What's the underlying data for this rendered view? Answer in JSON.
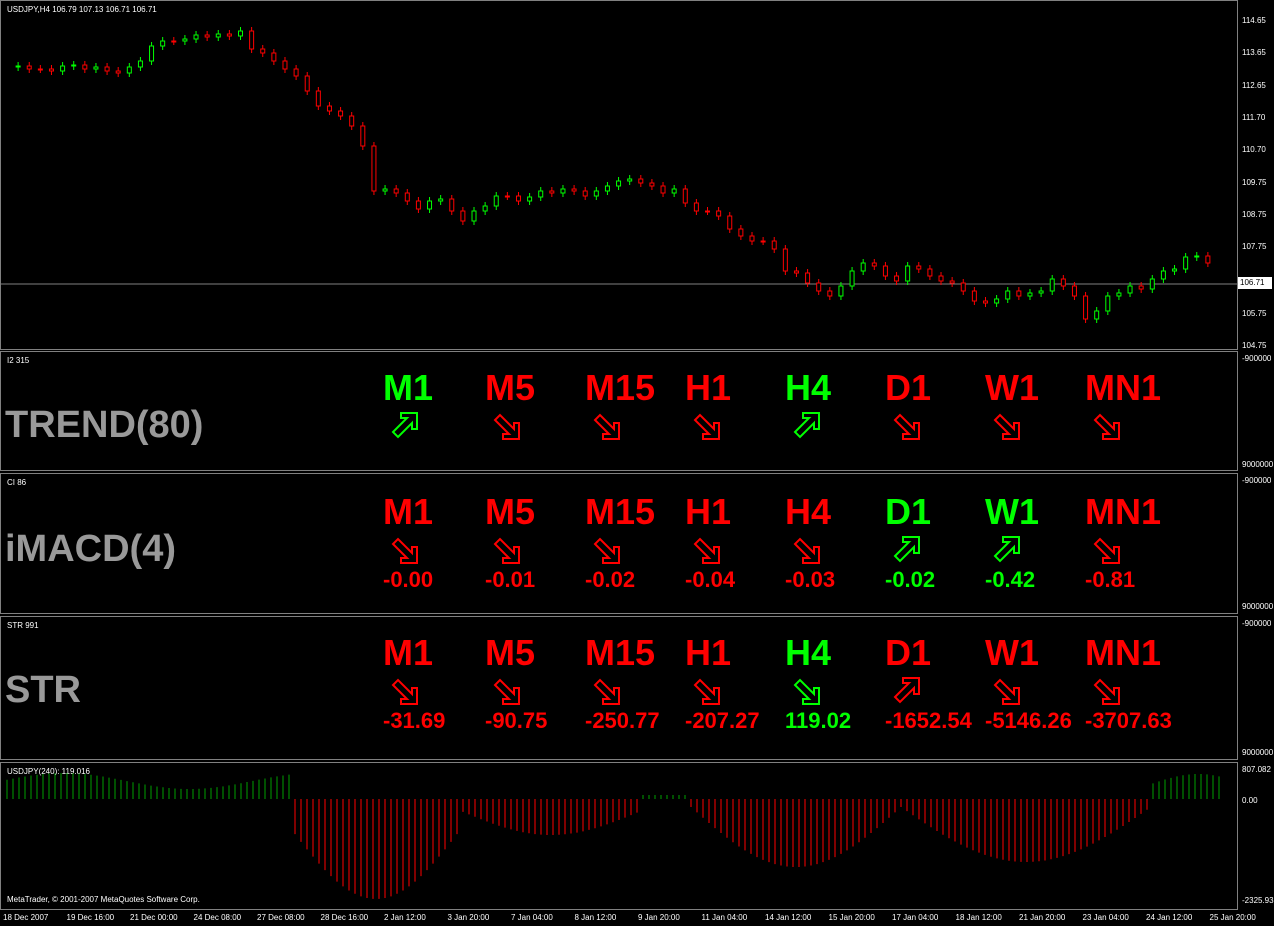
{
  "chart_title": "USDJPY,H4  106.79 107.13 106.71 106.71",
  "current_price": "106.71",
  "price_axis": [
    "114.65",
    "113.65",
    "112.65",
    "111.70",
    "110.70",
    "109.75",
    "108.75",
    "107.75",
    "105.75",
    "104.75"
  ],
  "date_axis": [
    "18 Dec 2007",
    "19 Dec 16:00",
    "21 Dec 00:00",
    "24 Dec 08:00",
    "27 Dec 08:00",
    "28 Dec 16:00",
    "2 Jan 12:00",
    "3 Jan 20:00",
    "7 Jan 04:00",
    "8 Jan 12:00",
    "9 Jan 20:00",
    "11 Jan 04:00",
    "14 Jan 12:00",
    "15 Jan 20:00",
    "17 Jan 04:00",
    "18 Jan 12:00",
    "21 Jan 20:00",
    "23 Jan 04:00",
    "24 Jan 12:00",
    "25 Jan 20:00"
  ],
  "colors": {
    "up": "#00ff00",
    "down": "#ff0000",
    "bg": "#000000"
  },
  "trend": {
    "pane_title": "I2 315",
    "name": "TREND(80)",
    "axis_top": "-900000",
    "axis_bottom": "9000000",
    "items": [
      {
        "tf": "M1",
        "dir": "up"
      },
      {
        "tf": "M5",
        "dir": "down"
      },
      {
        "tf": "M15",
        "dir": "down"
      },
      {
        "tf": "H1",
        "dir": "down"
      },
      {
        "tf": "H4",
        "dir": "up"
      },
      {
        "tf": "D1",
        "dir": "down"
      },
      {
        "tf": "W1",
        "dir": "down"
      },
      {
        "tf": "MN1",
        "dir": "down"
      }
    ]
  },
  "imacd": {
    "pane_title": "CI 86",
    "name": "iMACD(4)",
    "axis_top": "-900000",
    "axis_bottom": "9000000",
    "items": [
      {
        "tf": "M1",
        "dir": "down",
        "val": "-0.00"
      },
      {
        "tf": "M5",
        "dir": "down",
        "val": "-0.01"
      },
      {
        "tf": "M15",
        "dir": "down",
        "val": "-0.02"
      },
      {
        "tf": "H1",
        "dir": "down",
        "val": "-0.04"
      },
      {
        "tf": "H4",
        "dir": "down",
        "val": "-0.03"
      },
      {
        "tf": "D1",
        "dir": "up",
        "val": "-0.02"
      },
      {
        "tf": "W1",
        "dir": "up",
        "val": "-0.42"
      },
      {
        "tf": "MN1",
        "dir": "down",
        "val": "-0.81"
      }
    ]
  },
  "str": {
    "pane_title": "STR 991",
    "name": "STR",
    "axis_top": "-900000",
    "axis_bottom": "9000000",
    "items": [
      {
        "tf": "M1",
        "dir": "down",
        "val": "-31.69"
      },
      {
        "tf": "M5",
        "dir": "down",
        "val": "-90.75"
      },
      {
        "tf": "M15",
        "dir": "down",
        "val": "-250.77"
      },
      {
        "tf": "H1",
        "dir": "down",
        "val": "-207.27"
      },
      {
        "tf": "H4",
        "dir": "down",
        "color": "green",
        "val": "119.02"
      },
      {
        "tf": "D1",
        "dir": "up",
        "color": "red",
        "val": "-1652.54"
      },
      {
        "tf": "W1",
        "dir": "down",
        "val": "-5146.26"
      },
      {
        "tf": "MN1",
        "dir": "down",
        "val": "-3707.63"
      }
    ]
  },
  "hist": {
    "pane_title": "USDJPY(240):  119.016",
    "axis": [
      "807.082",
      "0.00",
      "-2325.93"
    ]
  },
  "copyright": "MetaTrader, © 2001-2007 MetaQuotes Software Corp."
}
